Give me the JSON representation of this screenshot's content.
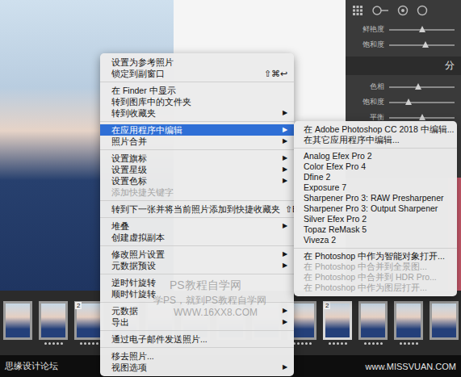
{
  "context_menu": {
    "items": [
      {
        "kind": "item",
        "label": "设置为参考照片",
        "shortcut": "",
        "arrow": "",
        "disabled": false,
        "selected": false
      },
      {
        "kind": "item",
        "label": "锁定到副窗口",
        "shortcut": "⇧⌘↩",
        "arrow": "",
        "disabled": false,
        "selected": false
      },
      {
        "kind": "separator"
      },
      {
        "kind": "item",
        "label": "在 Finder 中显示",
        "shortcut": "",
        "arrow": "",
        "disabled": false,
        "selected": false
      },
      {
        "kind": "item",
        "label": "转到图库中的文件夹",
        "shortcut": "",
        "arrow": "",
        "disabled": false,
        "selected": false
      },
      {
        "kind": "item",
        "label": "转到收藏夹",
        "shortcut": "",
        "arrow": "▶",
        "disabled": false,
        "selected": false
      },
      {
        "kind": "separator"
      },
      {
        "kind": "item",
        "label": "在应用程序中编辑",
        "shortcut": "",
        "arrow": "▶",
        "disabled": false,
        "selected": true
      },
      {
        "kind": "item",
        "label": "照片合并",
        "shortcut": "",
        "arrow": "▶",
        "disabled": false,
        "selected": false
      },
      {
        "kind": "separator"
      },
      {
        "kind": "item",
        "label": "设置旗标",
        "shortcut": "",
        "arrow": "▶",
        "disabled": false,
        "selected": false
      },
      {
        "kind": "item",
        "label": "设置星级",
        "shortcut": "",
        "arrow": "▶",
        "disabled": false,
        "selected": false
      },
      {
        "kind": "item",
        "label": "设置色标",
        "shortcut": "",
        "arrow": "▶",
        "disabled": false,
        "selected": false
      },
      {
        "kind": "item",
        "label": "添加快捷关键字",
        "shortcut": "",
        "arrow": "",
        "disabled": true,
        "selected": false
      },
      {
        "kind": "separator"
      },
      {
        "kind": "item",
        "label": "转到下一张并将当前照片添加到快捷收藏夹",
        "shortcut": "⇧B",
        "arrow": "",
        "disabled": false,
        "selected": false
      },
      {
        "kind": "separator"
      },
      {
        "kind": "item",
        "label": "堆叠",
        "shortcut": "",
        "arrow": "▶",
        "disabled": false,
        "selected": false
      },
      {
        "kind": "item",
        "label": "创建虚拟副本",
        "shortcut": "",
        "arrow": "",
        "disabled": false,
        "selected": false
      },
      {
        "kind": "separator"
      },
      {
        "kind": "item",
        "label": "修改照片设置",
        "shortcut": "",
        "arrow": "▶",
        "disabled": false,
        "selected": false
      },
      {
        "kind": "item",
        "label": "元数据预设",
        "shortcut": "",
        "arrow": "▶",
        "disabled": false,
        "selected": false
      },
      {
        "kind": "separator"
      },
      {
        "kind": "item",
        "label": "逆时针旋转",
        "shortcut": "",
        "arrow": "",
        "disabled": false,
        "selected": false
      },
      {
        "kind": "item",
        "label": "顺时针旋转",
        "shortcut": "",
        "arrow": "",
        "disabled": false,
        "selected": false
      },
      {
        "kind": "separator"
      },
      {
        "kind": "item",
        "label": "元数据",
        "shortcut": "",
        "arrow": "▶",
        "disabled": false,
        "selected": false
      },
      {
        "kind": "item",
        "label": "导出",
        "shortcut": "",
        "arrow": "▶",
        "disabled": false,
        "selected": false
      },
      {
        "kind": "separator"
      },
      {
        "kind": "item",
        "label": "通过电子邮件发送照片...",
        "shortcut": "",
        "arrow": "",
        "disabled": false,
        "selected": false
      },
      {
        "kind": "separator"
      },
      {
        "kind": "item",
        "label": "移去照片...",
        "shortcut": "",
        "arrow": "",
        "disabled": false,
        "selected": false
      },
      {
        "kind": "item",
        "label": "视图选项",
        "shortcut": "",
        "arrow": "▶",
        "disabled": false,
        "selected": false
      }
    ]
  },
  "submenu": {
    "items": [
      {
        "kind": "item",
        "label": "在 Adobe Photoshop CC 2018 中编辑...",
        "disabled": false
      },
      {
        "kind": "item",
        "label": "在其它应用程序中编辑...",
        "disabled": false
      },
      {
        "kind": "separator"
      },
      {
        "kind": "item",
        "label": "Analog Efex Pro 2",
        "disabled": false
      },
      {
        "kind": "item",
        "label": "Color Efex Pro 4",
        "disabled": false
      },
      {
        "kind": "item",
        "label": "Dfine 2",
        "disabled": false
      },
      {
        "kind": "item",
        "label": "Exposure 7",
        "disabled": false
      },
      {
        "kind": "item",
        "label": "Sharpener Pro 3: RAW Presharpener",
        "disabled": false
      },
      {
        "kind": "item",
        "label": "Sharpener Pro 3: Output Sharpener",
        "disabled": false
      },
      {
        "kind": "item",
        "label": "Silver Efex Pro 2",
        "disabled": false
      },
      {
        "kind": "item",
        "label": "Topaz ReMask 5",
        "disabled": false
      },
      {
        "kind": "item",
        "label": "Viveza 2",
        "disabled": false
      },
      {
        "kind": "separator"
      },
      {
        "kind": "item",
        "label": "在 Photoshop 中作为智能对象打开...",
        "disabled": false
      },
      {
        "kind": "item",
        "label": "在 Photoshop 中合并到全景图...",
        "disabled": true
      },
      {
        "kind": "item",
        "label": "在 Photoshop 中合并到 HDR Pro...",
        "disabled": true
      },
      {
        "kind": "item",
        "label": "在 Photoshop 中作为图层打开...",
        "disabled": true
      }
    ]
  },
  "develop_panel": {
    "top_sliders": [
      {
        "label": "鲜艳度",
        "level": 0.5
      },
      {
        "label": "饱和度",
        "level": 0.55
      }
    ],
    "heading": "分",
    "sliders": [
      {
        "label": "色相",
        "level": 0.45
      },
      {
        "label": "饱和度",
        "level": 0.3
      },
      {
        "label": "平衡",
        "level": 0.5
      }
    ]
  },
  "filmstrip": {
    "thumbs": [
      {
        "badge": "",
        "stars": 0,
        "selected": false
      },
      {
        "badge": "",
        "stars": 5,
        "selected": false
      },
      {
        "badge": "2",
        "stars": 5,
        "selected": false
      },
      {
        "badge": "",
        "stars": 0,
        "selected": false
      },
      {
        "badge": "",
        "stars": 0,
        "selected": false
      },
      {
        "badge": "",
        "stars": 0,
        "selected": false
      },
      {
        "badge": "",
        "stars": 0,
        "selected": false
      },
      {
        "badge": "",
        "stars": 0,
        "selected": false
      },
      {
        "badge": "",
        "stars": 5,
        "selected": false
      },
      {
        "badge": "2",
        "stars": 5,
        "selected": true
      },
      {
        "badge": "",
        "stars": 5,
        "selected": false
      },
      {
        "badge": "",
        "stars": 5,
        "selected": false
      },
      {
        "badge": "",
        "stars": 0,
        "selected": false
      }
    ]
  },
  "watermarks": [
    "PS教程自学网",
    "学PS，就到PS教程自学网",
    "WWW.16XX8.COM"
  ],
  "footer": {
    "left": "思缘设计论坛",
    "right": "www.MISSVUAN.COM"
  }
}
